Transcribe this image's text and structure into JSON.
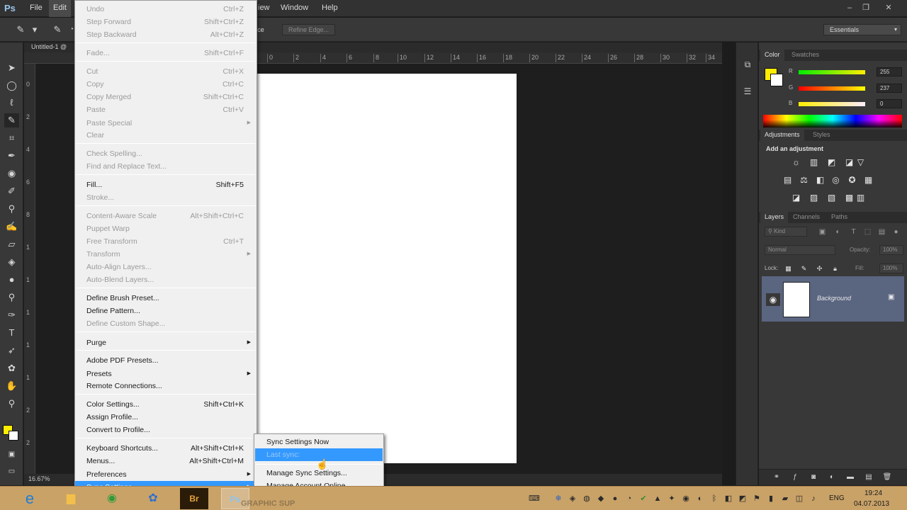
{
  "app": {
    "logo": "Ps",
    "menus": [
      "File",
      "Edit",
      "iew",
      "Window",
      "Help"
    ],
    "window_controls": [
      "–",
      "❐",
      "✕"
    ]
  },
  "options": {
    "refine_edge": "Refine Edge...",
    "partial_label": "ce",
    "workspace": "Essentials"
  },
  "document": {
    "tab_label": "Untitled-1 @",
    "zoom": "16.67%",
    "ruler_h": [
      "0",
      "2",
      "4",
      "6",
      "8",
      "10",
      "12",
      "14",
      "16",
      "18",
      "20",
      "22",
      "24",
      "26",
      "28",
      "30",
      "32",
      "34"
    ],
    "ruler_v": [
      "0",
      "2",
      "4",
      "6",
      "8",
      "1",
      "1",
      "1",
      "1",
      "1",
      "2",
      "2"
    ]
  },
  "edit_menu": {
    "items": [
      {
        "label": "Undo",
        "shortcut": "Ctrl+Z",
        "disabled": true
      },
      {
        "label": "Step Forward",
        "shortcut": "Shift+Ctrl+Z",
        "disabled": true
      },
      {
        "label": "Step Backward",
        "shortcut": "Alt+Ctrl+Z",
        "disabled": true
      },
      {
        "label": "Fade...",
        "shortcut": "Shift+Ctrl+F",
        "disabled": true
      },
      {
        "label": "Cut",
        "shortcut": "Ctrl+X",
        "disabled": true
      },
      {
        "label": "Copy",
        "shortcut": "Ctrl+C",
        "disabled": true
      },
      {
        "label": "Copy Merged",
        "shortcut": "Shift+Ctrl+C",
        "disabled": true
      },
      {
        "label": "Paste",
        "shortcut": "Ctrl+V",
        "disabled": true
      },
      {
        "label": "Paste Special",
        "shortcut": "",
        "disabled": true
      },
      {
        "label": "Clear",
        "shortcut": "",
        "disabled": true
      },
      {
        "label": "Check Spelling...",
        "shortcut": "",
        "disabled": true
      },
      {
        "label": "Find and Replace Text...",
        "shortcut": "",
        "disabled": true
      },
      {
        "label": "Fill...",
        "shortcut": "Shift+F5",
        "disabled": false
      },
      {
        "label": "Stroke...",
        "shortcut": "",
        "disabled": true
      },
      {
        "label": "Content-Aware Scale",
        "shortcut": "Alt+Shift+Ctrl+C",
        "disabled": true
      },
      {
        "label": "Puppet Warp",
        "shortcut": "",
        "disabled": true
      },
      {
        "label": "Free Transform",
        "shortcut": "Ctrl+T",
        "disabled": true
      },
      {
        "label": "Transform",
        "shortcut": "",
        "disabled": true
      },
      {
        "label": "Auto-Align Layers...",
        "shortcut": "",
        "disabled": true
      },
      {
        "label": "Auto-Blend Layers...",
        "shortcut": "",
        "disabled": true
      },
      {
        "label": "Define Brush Preset...",
        "shortcut": "",
        "disabled": false
      },
      {
        "label": "Define Pattern...",
        "shortcut": "",
        "disabled": false
      },
      {
        "label": "Define Custom Shape...",
        "shortcut": "",
        "disabled": true
      },
      {
        "label": "Purge",
        "shortcut": "",
        "disabled": false
      },
      {
        "label": "Adobe PDF Presets...",
        "shortcut": "",
        "disabled": false
      },
      {
        "label": "Presets",
        "shortcut": "",
        "disabled": false
      },
      {
        "label": "Remote Connections...",
        "shortcut": "",
        "disabled": false
      },
      {
        "label": "Color Settings...",
        "shortcut": "Shift+Ctrl+K",
        "disabled": false
      },
      {
        "label": "Assign Profile...",
        "shortcut": "",
        "disabled": false
      },
      {
        "label": "Convert to Profile...",
        "shortcut": "",
        "disabled": false
      },
      {
        "label": "Keyboard Shortcuts...",
        "shortcut": "Alt+Shift+Ctrl+K",
        "disabled": false
      },
      {
        "label": "Menus...",
        "shortcut": "Alt+Shift+Ctrl+M",
        "disabled": false
      },
      {
        "label": "Preferences",
        "shortcut": "",
        "disabled": false
      },
      {
        "label": "Sync Settings",
        "shortcut": "",
        "disabled": false
      }
    ]
  },
  "sync_submenu": {
    "items": [
      "Sync Settings Now",
      "Last sync:",
      "Manage Sync Settings...",
      "Manage Account Online..."
    ]
  },
  "panels": {
    "color_tabs": [
      "Color",
      "Swatches"
    ],
    "channels": [
      {
        "label": "R",
        "value": "255"
      },
      {
        "label": "G",
        "value": "237"
      },
      {
        "label": "B",
        "value": "0"
      }
    ],
    "foreground_color": "#ffed00",
    "adjust_tabs": [
      "Adjustments",
      "Styles"
    ],
    "adjust_title": "Add an adjustment",
    "layer_tabs": [
      "Layers",
      "Channels",
      "Paths"
    ],
    "kind_label": "Kind",
    "blend_mode": "Normal",
    "opacity_label": "Opacity:",
    "opacity_value": "100%",
    "lock_label": "Lock:",
    "fill_label": "Fill:",
    "fill_value": "100%",
    "layer_name": "Background"
  },
  "taskbar": {
    "language": "ENG",
    "time": "19:24",
    "date": "04.07.2013",
    "watermark": "GRAPHIC SUP"
  }
}
